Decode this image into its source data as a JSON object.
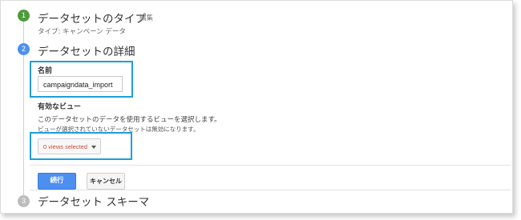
{
  "step1": {
    "number": "1",
    "title": "データセットのタイプ",
    "edit_label": "編集",
    "type_line": "タイプ: キャンペーン データ"
  },
  "step2": {
    "number": "2",
    "title": "データセットの詳細"
  },
  "name_field": {
    "label": "名前",
    "value": "campaigndata_import"
  },
  "views": {
    "label": "有効なビュー",
    "description": "このデータセットのデータを使用するビューを選択します。",
    "note": "ビューが選択されていないデータセットは無効になります。",
    "select_text": "0 views selected"
  },
  "buttons": {
    "continue": "続行",
    "cancel": "キャンセル"
  },
  "step3": {
    "number": "3",
    "title": "データセット スキーマ"
  },
  "colors": {
    "step_done": "#4f9a3c",
    "step_active": "#4d90f0",
    "step_pending": "#bdbdbd",
    "highlight": "#1d9fdb",
    "primary_button": "#4d8ef1",
    "warning_text": "#d14836"
  }
}
